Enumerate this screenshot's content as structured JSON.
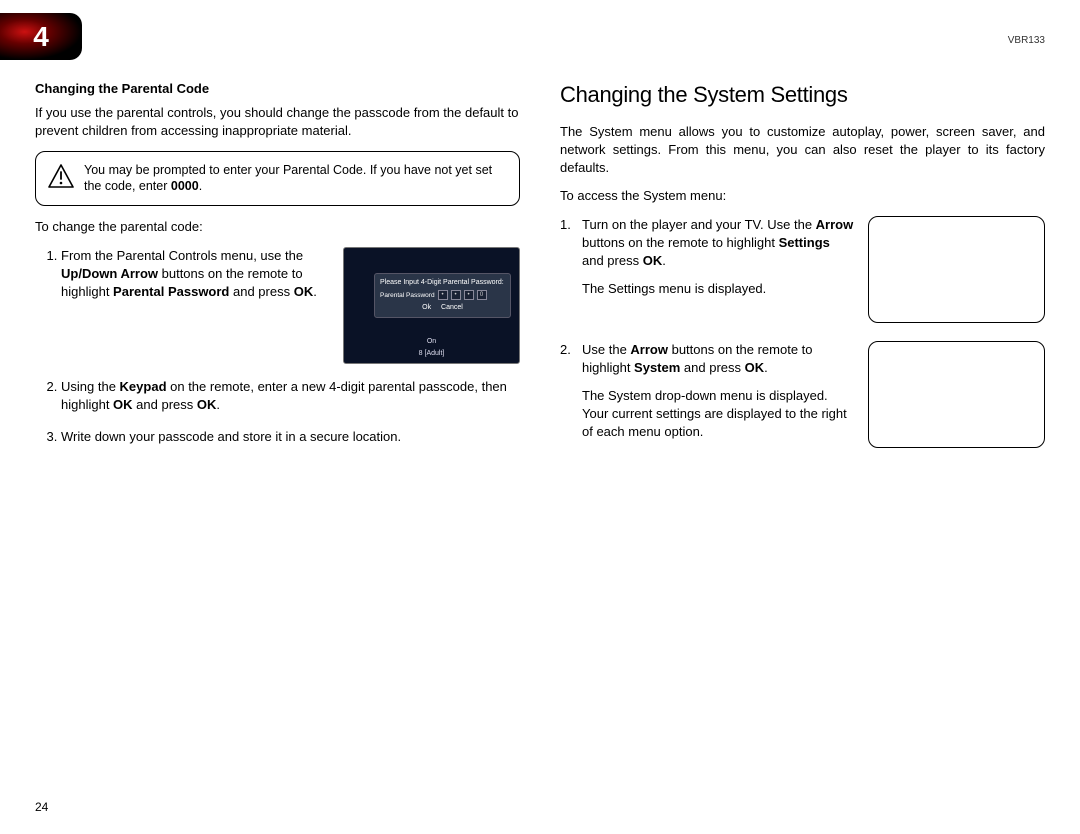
{
  "chapter_number": "4",
  "model": "VBR133",
  "page_number": "24",
  "left": {
    "heading": "Changing the Parental Code",
    "intro": "If you use the parental controls, you should change the passcode from the default to prevent children from accessing inappropriate material.",
    "note_prefix": "You may be prompted to enter your Parental Code. If you have not yet set the code, enter ",
    "note_code": "0000",
    "note_suffix": ".",
    "lead": "To change the parental code:",
    "step1_a": "From the Parental Controls menu, use the ",
    "step1_b": "Up/Down Arrow",
    "step1_c": " buttons on the remote to highlight ",
    "step1_d": "Parental Password",
    "step1_e": " and press ",
    "step1_f": "OK",
    "step1_g": ".",
    "step2_a": "Using the ",
    "step2_b": "Keypad",
    "step2_c": " on the remote, enter a new 4-digit parental passcode, then highlight ",
    "step2_d": "OK",
    "step2_e": " and press ",
    "step2_f": "OK",
    "step2_g": ".",
    "step3": "Write down your passcode and store it in a secure location.",
    "screenshot": {
      "dialog_title": "Please Input 4-Digit Parental Password:",
      "row_label": "Parental Password",
      "digits": [
        "•",
        "•",
        "•",
        "0"
      ],
      "btn_ok": "Ok",
      "btn_cancel": "Cancel",
      "status1": "On",
      "status2": "8 [Adult]"
    }
  },
  "right": {
    "title": "Changing the System Settings",
    "intro": "The System menu allows you to customize autoplay, power, screen saver, and network settings. From this menu, you can also reset the player to its factory defaults.",
    "lead": "To access the System menu:",
    "step1_num": "1.",
    "step1_a": "Turn on the player and your TV. Use the ",
    "step1_b": "Arrow",
    "step1_c": " buttons on the remote to highlight ",
    "step1_d": "Settings",
    "step1_e": " and press ",
    "step1_f": "OK",
    "step1_g": ".",
    "step1_result": "The Settings menu is displayed.",
    "step2_num": "2.",
    "step2_a": "Use the ",
    "step2_b": "Arrow",
    "step2_c": " buttons on the remote to highlight ",
    "step2_d": "System",
    "step2_e": " and press ",
    "step2_f": "OK",
    "step2_g": ".",
    "step2_result": "The System drop-down menu is displayed. Your current settings are displayed to the right of each menu option."
  }
}
